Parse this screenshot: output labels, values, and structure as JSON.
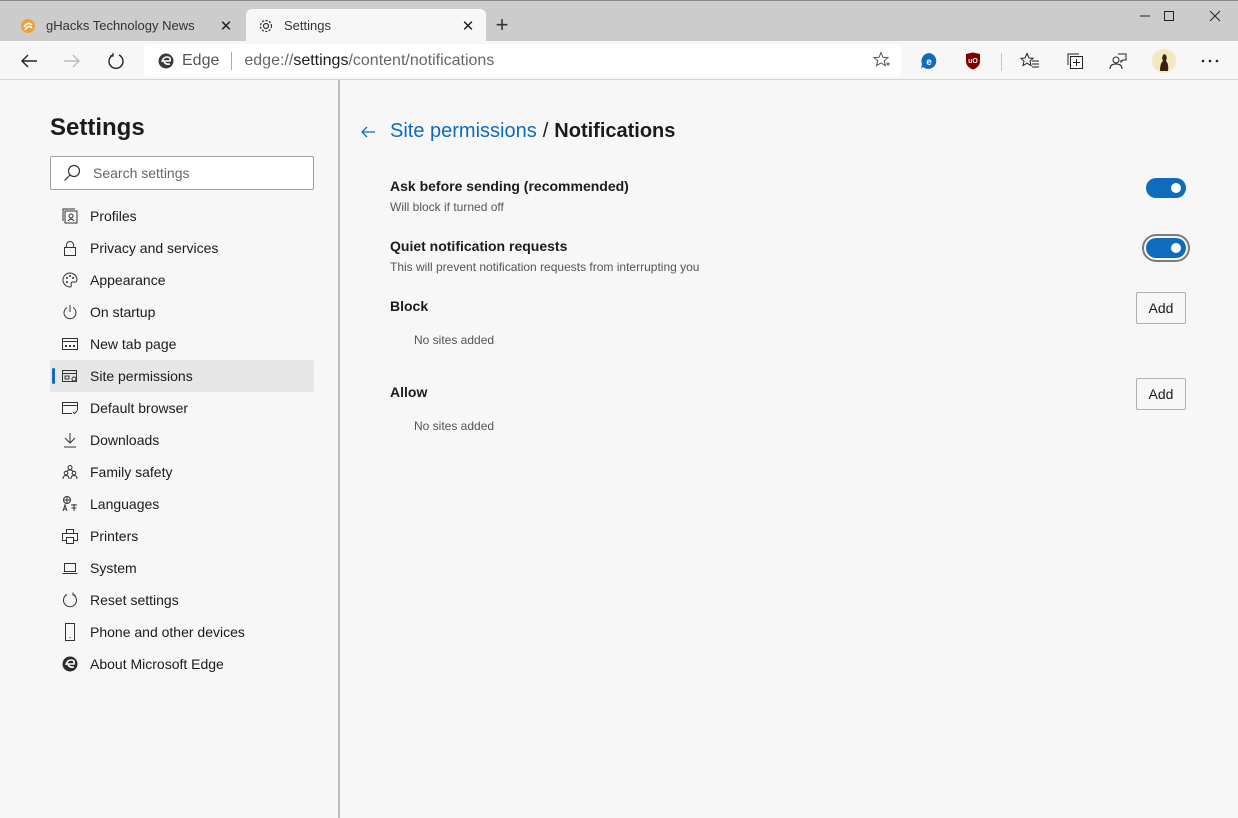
{
  "browser": {
    "tabs": [
      {
        "title": "gHacks Technology News",
        "icon": "ghacks-favicon",
        "active": false
      },
      {
        "title": "Settings",
        "icon": "gear-icon",
        "active": true
      }
    ],
    "window_controls": {
      "minimize": "minimize-icon",
      "maximize": "maximize-icon",
      "close": "close-icon"
    },
    "omnibox": {
      "scheme_label": "Edge",
      "url_prefix": "edge://",
      "url_host": "settings",
      "url_path": "/content/notifications"
    },
    "toolbar_icons": [
      "favorites-add-icon",
      "edge-extension-icon",
      "ublock-icon",
      "favorites-icon",
      "collections-icon",
      "feedback-icon",
      "profile-avatar",
      "more-icon"
    ]
  },
  "sidebar": {
    "title": "Settings",
    "search_placeholder": "Search settings",
    "items": [
      {
        "label": "Profiles",
        "icon": "profile-icon"
      },
      {
        "label": "Privacy and services",
        "icon": "lock-icon"
      },
      {
        "label": "Appearance",
        "icon": "palette-icon"
      },
      {
        "label": "On startup",
        "icon": "power-icon"
      },
      {
        "label": "New tab page",
        "icon": "new-tab-icon"
      },
      {
        "label": "Site permissions",
        "icon": "site-permissions-icon",
        "selected": true
      },
      {
        "label": "Default browser",
        "icon": "default-browser-icon"
      },
      {
        "label": "Downloads",
        "icon": "download-icon"
      },
      {
        "label": "Family safety",
        "icon": "family-icon"
      },
      {
        "label": "Languages",
        "icon": "languages-icon"
      },
      {
        "label": "Printers",
        "icon": "printer-icon"
      },
      {
        "label": "System",
        "icon": "laptop-icon"
      },
      {
        "label": "Reset settings",
        "icon": "reset-icon"
      },
      {
        "label": "Phone and other devices",
        "icon": "phone-icon"
      },
      {
        "label": "About Microsoft Edge",
        "icon": "edge-logo-icon"
      }
    ]
  },
  "main": {
    "breadcrumb_parent": "Site permissions",
    "breadcrumb_separator": "/",
    "breadcrumb_current": "Notifications",
    "settings": [
      {
        "label": "Ask before sending (recommended)",
        "description": "Will block if turned off",
        "enabled": true
      },
      {
        "label": "Quiet notification requests",
        "description": "This will prevent notification requests from interrupting you",
        "enabled": true
      }
    ],
    "lists": [
      {
        "title": "Block",
        "button": "Add",
        "empty_text": "No sites added"
      },
      {
        "title": "Allow",
        "button": "Add",
        "empty_text": "No sites added"
      }
    ]
  },
  "colors": {
    "accent": "#0f6cbd",
    "background": "#f7f7f7",
    "titlebar": "#cccccc"
  }
}
